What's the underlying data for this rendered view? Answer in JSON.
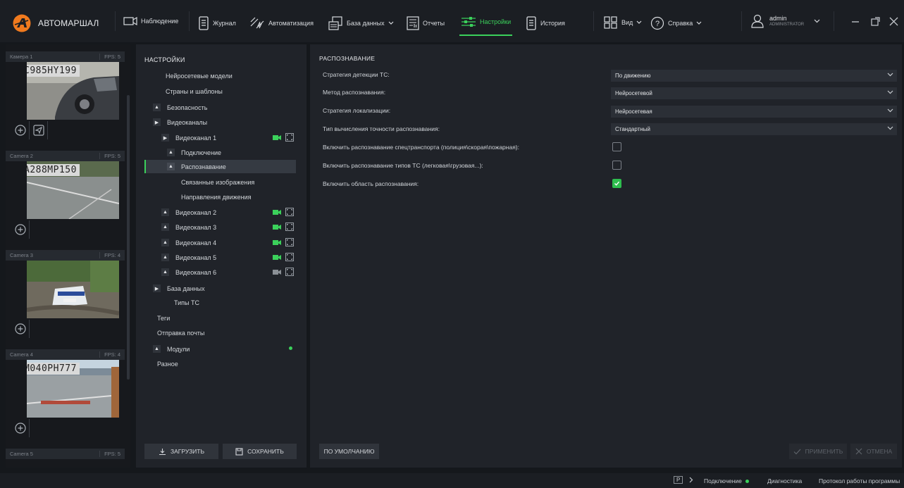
{
  "app": {
    "title": "АВТОМАРШАЛ"
  },
  "nav": {
    "observation": "Наблюдение",
    "journal": "Журнал",
    "automation": "Автоматизация",
    "database": "База данных",
    "reports": "Отчеты",
    "settings": "Настройки",
    "history": "История",
    "view": "Вид",
    "help": "Справка"
  },
  "user": {
    "name": "admin",
    "role": "ADMINISTRATOR"
  },
  "cameras": [
    {
      "name": "Камера 1",
      "fps": "FPS: 5",
      "plate": "C985HY199"
    },
    {
      "name": "Camera 2",
      "fps": "FPS: 5",
      "plate": "A288MP150"
    },
    {
      "name": "Camera 3",
      "fps": "FPS: 4",
      "plate": ""
    },
    {
      "name": "Camera 4",
      "fps": "FPS: 4",
      "plate": "M040PH777"
    },
    {
      "name": "Camera 5",
      "fps": "FPS: 5",
      "plate": ""
    }
  ],
  "tree": {
    "title": "НАСТРОЙКИ",
    "items": [
      "Нейросетевые модели",
      "Страны и шаблоны",
      "Безопасность",
      "Видеоканалы",
      "Видеоканал 1",
      "Подключение",
      "Распознавание",
      "Связанные изображения",
      "Направления движения",
      "Видеоканал 2",
      "Видеоканал 3",
      "Видеоканал 4",
      "Видеоканал 5",
      "Видеоканал 6",
      "База данных",
      "Типы ТС",
      "Теги",
      "Отправка почты",
      "Модули",
      "Разное"
    ],
    "load_label": "ЗАГРУЗИТЬ",
    "save_label": "СОХРАНИТЬ"
  },
  "settings": {
    "title": "РАСПОЗНАВАНИЕ",
    "fields": [
      {
        "label": "Стратегия детекции ТС:",
        "value": "По движению"
      },
      {
        "label": "Метод распознавания:",
        "value": "Нейросетевой"
      },
      {
        "label": "Стратегия локализации:",
        "value": "Нейросетевая"
      },
      {
        "label": "Тип вычисления точности распознавания:",
        "value": "Стандартный"
      }
    ],
    "checks": [
      {
        "label": "Включить распознавание спецтранспорта (полиция\\скорая\\пожарная):",
        "checked": false
      },
      {
        "label": "Включить распознавание типов ТС (легковая\\грузовая...):",
        "checked": false
      },
      {
        "label": "Включить область распознавания:",
        "checked": true
      }
    ],
    "default_label": "ПО УМОЛЧАНИЮ",
    "apply_label": "ПРИМЕНИТЬ",
    "cancel_label": "ОТМЕНА"
  },
  "status": {
    "p_badge": "P",
    "connection": "Подключение",
    "diagnostics": "Диагностика",
    "log": "Протокол работы программы"
  },
  "colors": {
    "accent": "#3bd15b",
    "logo": "#f07a1e",
    "bg": "#15181c"
  }
}
